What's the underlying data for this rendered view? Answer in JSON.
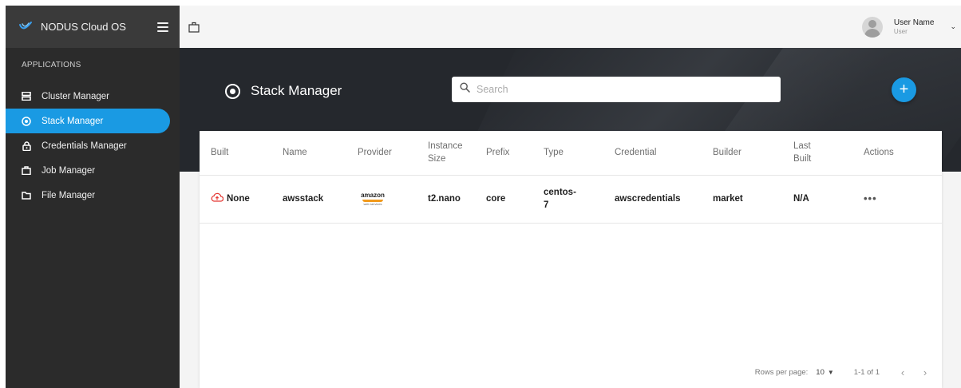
{
  "sidebar": {
    "app_title": "NODUS Cloud OS",
    "section_label": "APPLICATIONS",
    "items": [
      {
        "label": "Cluster Manager",
        "icon": "server-icon"
      },
      {
        "label": "Stack Manager",
        "icon": "target-icon",
        "active": true
      },
      {
        "label": "Credentials Manager",
        "icon": "lock-icon"
      },
      {
        "label": "Job Manager",
        "icon": "briefcase-icon"
      },
      {
        "label": "File Manager",
        "icon": "folder-icon"
      }
    ]
  },
  "topbar": {
    "user_name": "User Name",
    "user_role": "User"
  },
  "hero": {
    "title": "Stack Manager",
    "search_placeholder": "Search",
    "add_label": "+"
  },
  "table": {
    "columns": [
      "Built",
      "Name",
      "Provider",
      "Instance Size",
      "Prefix",
      "Type",
      "Credential",
      "Builder",
      "Last Built",
      "Actions"
    ],
    "rows": [
      {
        "built": "None",
        "name": "awsstack",
        "provider_logo_text": "amazon",
        "provider_logo_subtext": "web services",
        "instance_size": "t2.nano",
        "prefix": "core",
        "type": "centos-7",
        "credential": "awscredentials",
        "builder": "market",
        "last_built": "N/A",
        "actions": "•••"
      }
    ]
  },
  "pagination": {
    "rows_per_page_label": "Rows per page:",
    "rows_per_page_value": "10",
    "range": "1-1 of 1",
    "prev": "‹",
    "next": "›"
  },
  "colors": {
    "accent": "#1a9ae3",
    "sidebar_bg": "#2b2b2b",
    "hero_bg": "#25282d",
    "error_icon": "#e53935"
  }
}
